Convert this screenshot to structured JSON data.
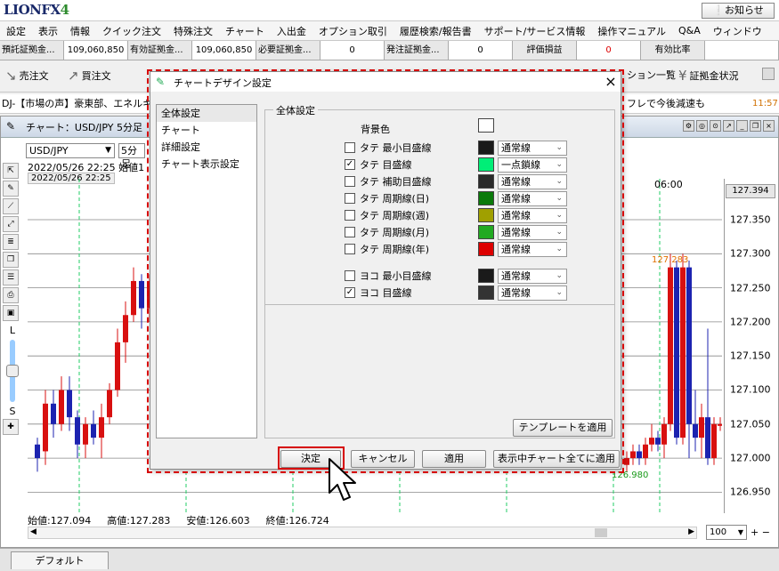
{
  "app": {
    "logo_text": "LIONFX",
    "logo_num": "4",
    "notice_button": "お知らせ"
  },
  "menu": [
    "設定",
    "表示",
    "情報",
    "クイック注文",
    "特殊注文",
    "チャート",
    "入出金",
    "オプション取引",
    "履歴検索/報告書",
    "サポート/サービス情報",
    "操作マニュアル",
    "Q&A",
    "ウィンドウ"
  ],
  "stats": [
    {
      "label": "預託証拠金...",
      "value": "109,060,850"
    },
    {
      "label": "有効証拠金...",
      "value": "109,060,850"
    },
    {
      "label": "必要証拠金...",
      "value": "0"
    },
    {
      "label": "発注証拠金...",
      "value": "0"
    },
    {
      "label": "評価損益",
      "value": "0"
    },
    {
      "label": "有効比率",
      "value": ""
    }
  ],
  "toolbar": {
    "sell": "売注文",
    "buy": "買注文",
    "position_list": "ション一覧",
    "margin": "証拠金状況"
  },
  "ticker": {
    "left": "DJ-【市場の声】豪東部、エネルギ",
    "right": "フレで今後減速も",
    "time": "11:57"
  },
  "chart": {
    "title": "チャート：USD/JPY 5分足",
    "symbol": "USD/JPY",
    "timeframe": "5分足",
    "date_line": "2022/05/26 22:25  始値1",
    "cursor_date": "2022/05/26 22:25",
    "time_label": "06:00",
    "last_price": "127.394",
    "price_labels": [
      "127.350",
      "127.300",
      "127.250",
      "127.200",
      "127.150",
      "127.100",
      "127.050",
      "127.000",
      "126.950"
    ],
    "high_marker": "127.283",
    "low_marker": "126.980",
    "ohlc": {
      "open": "始値:127.094",
      "high": "高値:127.283",
      "low": "安値:126.603",
      "close": "終値:126.724"
    },
    "zoom": "100",
    "left_tools": [
      "L",
      "S"
    ]
  },
  "bottom_tab": "デフォルト",
  "dialog": {
    "title": "チャートデザイン設定",
    "nav": [
      "全体設定",
      "チャート",
      "詳細設定",
      "チャート表示設定"
    ],
    "group_label": "全体設定",
    "background_label": "背景色",
    "background_color": "#ffffff",
    "rows": [
      {
        "label": "タテ 最小目盛線",
        "checked": false,
        "color": "#1a1a1a",
        "style": "通常線"
      },
      {
        "label": "タテ 目盛線",
        "checked": true,
        "color": "#00ee77",
        "style": "一点鎖線"
      },
      {
        "label": "タテ 補助目盛線",
        "checked": false,
        "color": "#2a2a2a",
        "style": "通常線"
      },
      {
        "label": "タテ 周期線(日)",
        "checked": false,
        "color": "#0a7a0a",
        "style": "通常線"
      },
      {
        "label": "タテ 周期線(週)",
        "checked": false,
        "color": "#a0a000",
        "style": "通常線"
      },
      {
        "label": "タテ 周期線(月)",
        "checked": false,
        "color": "#22aa22",
        "style": "通常線"
      },
      {
        "label": "タテ 周期線(年)",
        "checked": false,
        "color": "#dd0000",
        "style": "通常線"
      },
      {
        "label": "ヨコ 最小目盛線",
        "checked": false,
        "color": "#1a1a1a",
        "style": "通常線"
      },
      {
        "label": "ヨコ 目盛線",
        "checked": true,
        "color": "#333333",
        "style": "通常線"
      }
    ],
    "template_button": "テンプレートを適用",
    "buttons": {
      "ok": "決定",
      "cancel": "キャンセル",
      "apply": "適用",
      "apply_all": "表示中チャート全てに適用"
    }
  }
}
